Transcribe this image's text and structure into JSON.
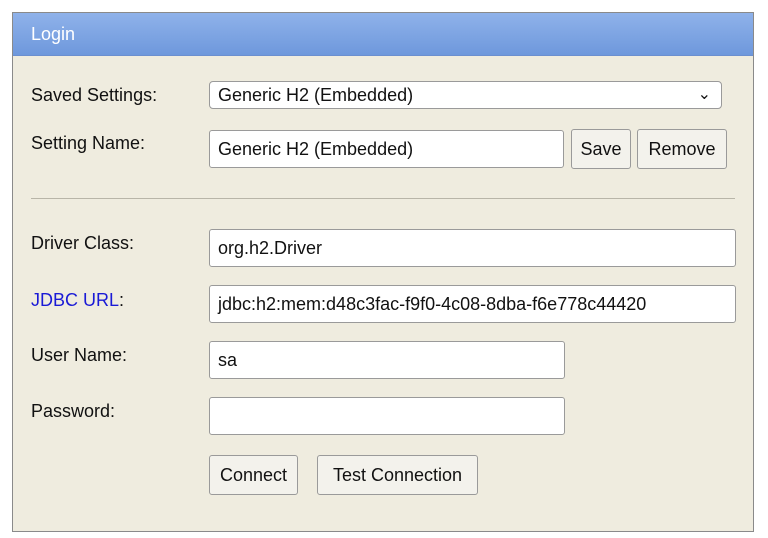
{
  "window": {
    "title": "Login"
  },
  "settings": {
    "saved_settings_label": "Saved Settings:",
    "saved_settings_value": "Generic H2 (Embedded)",
    "setting_name_label": "Setting Name:",
    "setting_name_value": "Generic H2 (Embedded)",
    "save_label": "Save",
    "remove_label": "Remove"
  },
  "connection": {
    "driver_class_label": "Driver Class:",
    "driver_class_value": "org.h2.Driver",
    "jdbc_url_label": "JDBC URL",
    "jdbc_url_colon": ":",
    "jdbc_url_value": "jdbc:h2:mem:d48c3fac-f9f0-4c08-8dba-f6e778c44420",
    "user_name_label": "User Name:",
    "user_name_value": "sa",
    "password_label": "Password:",
    "password_value": ""
  },
  "actions": {
    "connect_label": "Connect",
    "test_connection_label": "Test Connection"
  },
  "colors": {
    "titlebar": "#7ea5e3",
    "panel_background": "#efecdf",
    "link": "#1a1ad6"
  }
}
